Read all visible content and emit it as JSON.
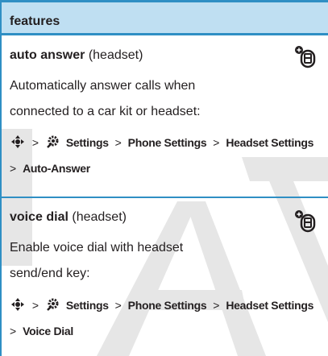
{
  "header": {
    "title": "features"
  },
  "watermark": {
    "text": "DRAFT"
  },
  "features": [
    {
      "name": "auto answer",
      "qualifier": "(headset)",
      "description": [
        "Automatically answer calls when",
        "connected to a car kit or headset:"
      ],
      "path_items": [
        "Settings",
        "Phone Settings",
        "Headset Settings",
        "Auto-Answer"
      ],
      "icon": "handsfree-headset-icon"
    },
    {
      "name": "voice dial",
      "qualifier": "(headset)",
      "description": [
        "Enable voice dial with headset",
        "send/end key:"
      ],
      "path_items": [
        "Settings",
        "Phone Settings",
        "Headset Settings",
        "Voice Dial"
      ],
      "icon": "handsfree-headset-icon"
    }
  ],
  "separator": ">",
  "colors": {
    "accent": "#2f8fc4",
    "header_bg": "#bfdff2",
    "watermark": "#e6e6e6"
  }
}
